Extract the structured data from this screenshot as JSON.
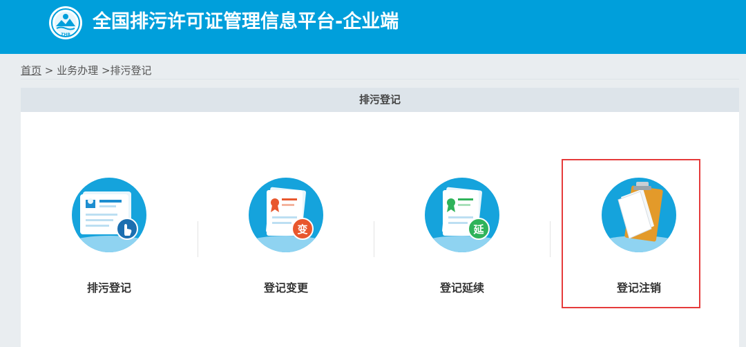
{
  "header": {
    "title": "全国排污许可证管理信息平台-企业端",
    "logo_icon": "environment-emblem-icon",
    "background_color": "#009fdb"
  },
  "breadcrumb": {
    "home": "首页",
    "separator": ">",
    "level1": "业务办理",
    "level2": "排污登记"
  },
  "panel": {
    "title": "排污登记"
  },
  "cards": [
    {
      "label": "排污登记",
      "icon": "registration-card-hand-icon"
    },
    {
      "label": "登记变更",
      "icon": "registration-change-icon",
      "badge": "变",
      "badge_color": "#e8572d"
    },
    {
      "label": "登记延续",
      "icon": "registration-extend-icon",
      "badge": "延",
      "badge_color": "#2fb35a"
    },
    {
      "label": "登记注销",
      "icon": "registration-cancel-clipboard-icon"
    }
  ],
  "highlight_color": "#e53a3a"
}
